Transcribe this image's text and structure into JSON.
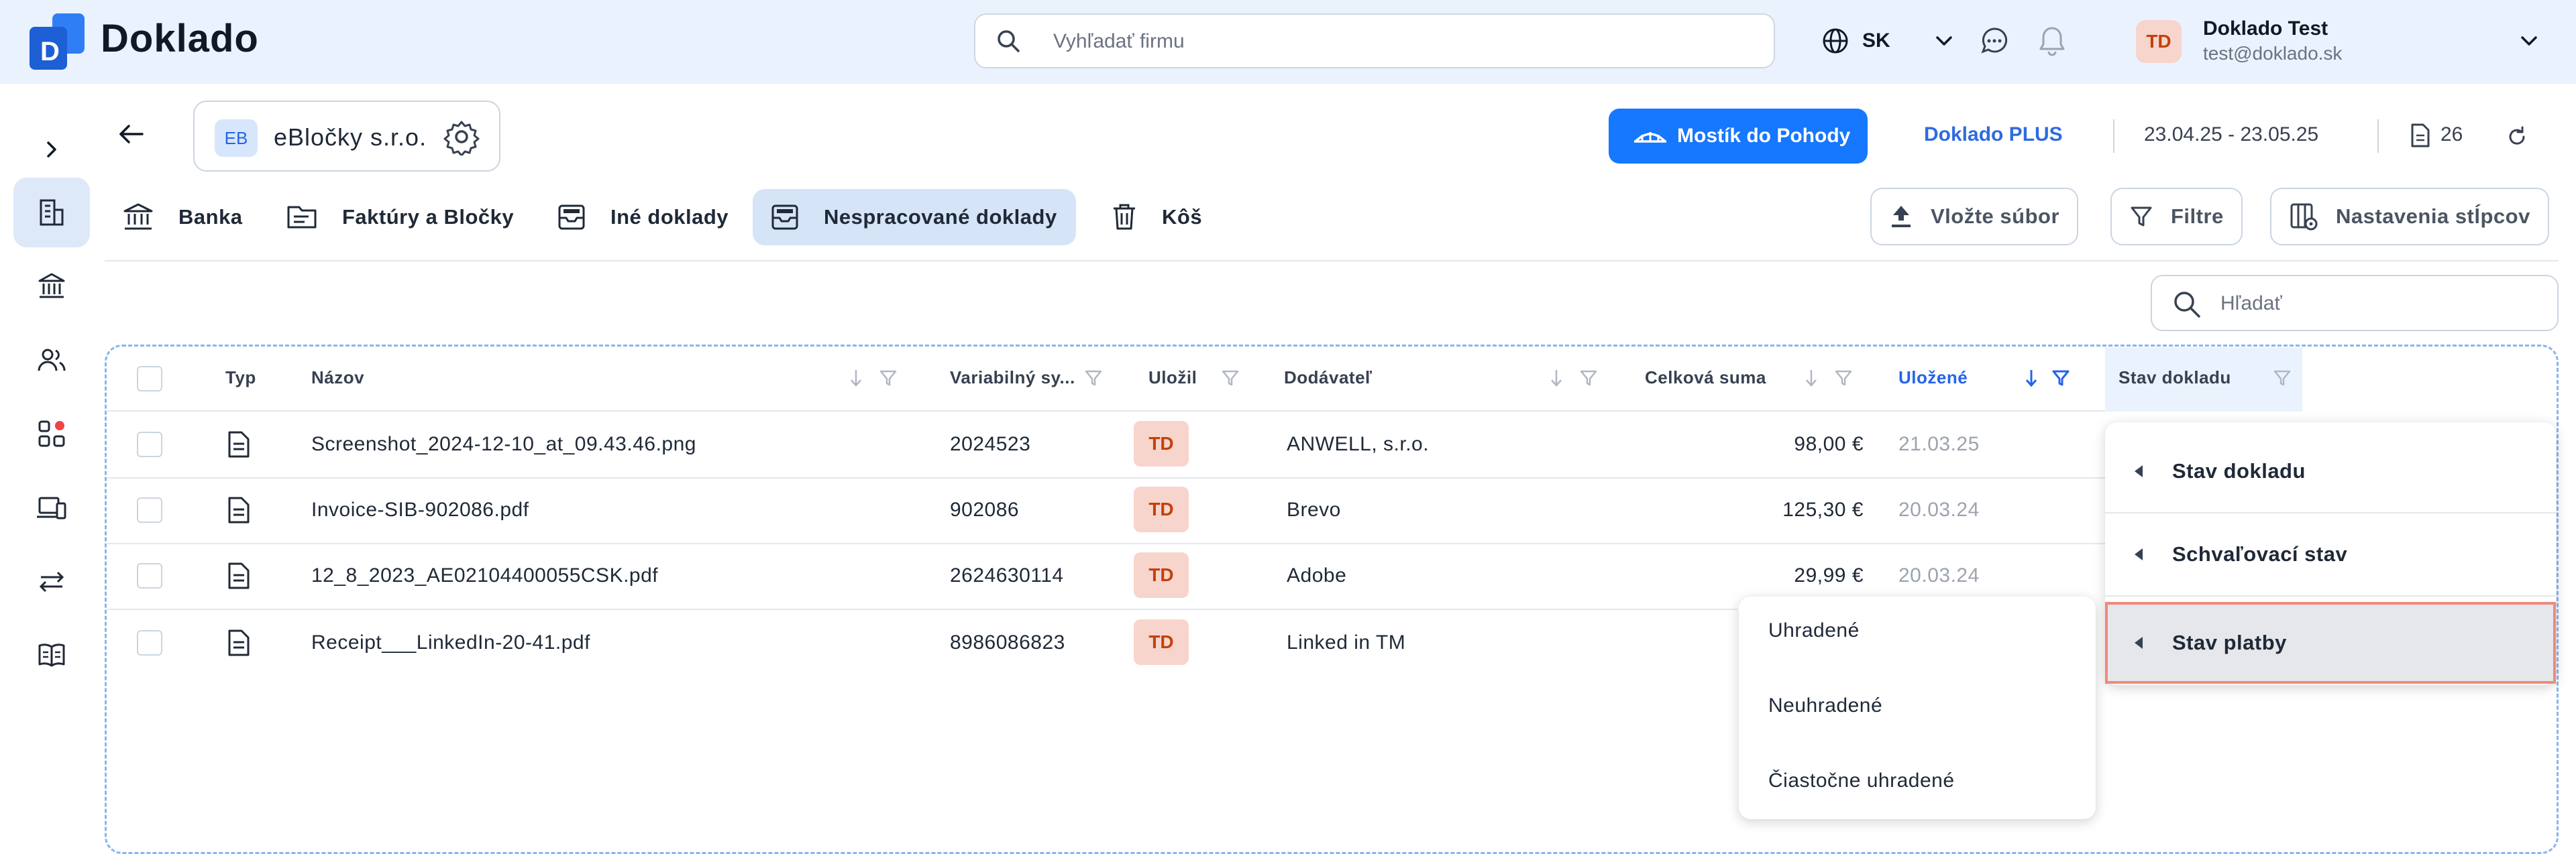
{
  "app": {
    "name": "Doklado"
  },
  "search": {
    "placeholder": "Vyhľadať firmu"
  },
  "language": {
    "code": "SK"
  },
  "user": {
    "initials": "TD",
    "name": "Doklado Test",
    "email": "test@doklado.sk"
  },
  "company": {
    "initials": "EB",
    "name": "eBločky s.r.o."
  },
  "toolbar": {
    "mostik_label": "Mostík do Pohody",
    "plan_label": "Doklado PLUS",
    "date_range": "23.04.25 - 23.05.25",
    "doc_count": "26"
  },
  "tabs": [
    {
      "label": "Banka"
    },
    {
      "label": "Faktúry a Bločky"
    },
    {
      "label": "Iné doklady"
    },
    {
      "label": "Nespracované doklady",
      "active": true
    },
    {
      "label": "Kôš"
    }
  ],
  "actions": {
    "upload": "Vložte súbor",
    "filters": "Filtre",
    "columns": "Nastavenia stĺpcov"
  },
  "table_search": {
    "placeholder": "Hľadať"
  },
  "table": {
    "headers": {
      "type": "Typ",
      "name": "Názov",
      "varsym": "Variabilný sy...",
      "saved_by": "Uložil",
      "supplier": "Dodávateľ",
      "total": "Celková suma",
      "saved": "Uložené",
      "status": "Stav dokladu"
    },
    "rows": [
      {
        "name": "Screenshot_2024-12-10_at_09.43.46.png",
        "varsym": "2024523",
        "saved_by": "TD",
        "supplier": "ANWELL, s.r.o.",
        "total": "98,00 €",
        "saved": "21.03.25"
      },
      {
        "name": "Invoice-SIB-902086.pdf",
        "varsym": "902086",
        "saved_by": "TD",
        "supplier": "Brevo",
        "total": "125,30 €",
        "saved": "20.03.24"
      },
      {
        "name": "12_8_2023_AE02104400055CSK.pdf",
        "varsym": "2624630114",
        "saved_by": "TD",
        "supplier": "Adobe",
        "total": "29,99 €",
        "saved": "20.03.24"
      },
      {
        "name": "Receipt___LinkedIn-20-41.pdf",
        "varsym": "8986086823",
        "saved_by": "TD",
        "supplier": "Linked in TM",
        "total": "",
        "saved": ""
      }
    ]
  },
  "context_menu": {
    "items": [
      {
        "label": "Stav dokladu"
      },
      {
        "label": "Schvaľovací stav"
      },
      {
        "label": "Stav platby",
        "highlighted": true
      }
    ]
  },
  "submenu": {
    "items": [
      {
        "label": "Uhradené"
      },
      {
        "label": "Neuhradené"
      },
      {
        "label": "Čiastočne uhradené"
      }
    ]
  },
  "colors": {
    "accent": "#1677ff",
    "active_tab": "#d6e4f8",
    "topbar": "#eaf2fd",
    "highlight_border": "#f08a7c",
    "badge_bg": "#f7d5cc"
  }
}
